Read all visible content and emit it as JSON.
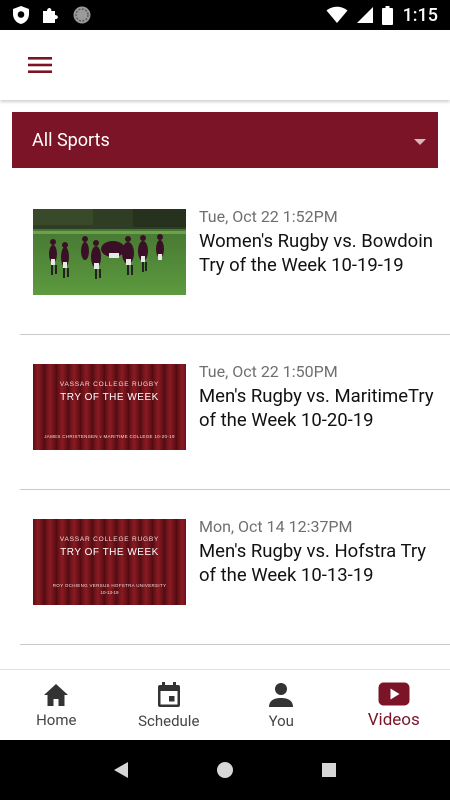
{
  "status_bar": {
    "time": "1:15",
    "icons": [
      "shield-icon",
      "puzzle-icon",
      "circle-icon",
      "wifi-icon",
      "signal-icon",
      "battery-icon"
    ]
  },
  "app_bar": {
    "menu_icon": "hamburger-menu-icon"
  },
  "filter": {
    "label": "All Sports",
    "icon": "dropdown-arrow-icon"
  },
  "videos": [
    {
      "date": "Tue, Oct 22 1:52PM",
      "title": "Women's Rugby vs. Bowdoin Try of the Week 10-19-19",
      "thumbnail": "rugby-field-photo"
    },
    {
      "date": "Tue, Oct 22 1:50PM",
      "title": "Men's Rugby vs. MaritimeTry of the Week 10-20-19",
      "thumbnail": {
        "kind": "curtain-title-card",
        "subtitle": "VASSAR COLLEGE RUGBY",
        "heading": "TRY OF THE WEEK",
        "footer": "JAMES CHRISTENSEN v MARITIME COLLEGE 10-20-19",
        "footer2": ""
      }
    },
    {
      "date": "Mon, Oct 14 12:37PM",
      "title": "Men's Rugby vs. Hofstra Try of the Week 10-13-19",
      "thumbnail": {
        "kind": "curtain-title-card",
        "subtitle": "VASSAR COLLEGE RUGBY",
        "heading": "TRY OF THE WEEK",
        "footer": "ROY OCHIENG VERSUS HOFSTRA UNIVERSITY",
        "footer2": "10-13-19"
      }
    }
  ],
  "bottom_nav": {
    "items": [
      {
        "label": "Home",
        "icon": "home-icon"
      },
      {
        "label": "Schedule",
        "icon": "calendar-icon"
      },
      {
        "label": "You",
        "icon": "person-icon"
      },
      {
        "label": "Videos",
        "icon": "youtube-play-icon"
      }
    ],
    "active": "Videos"
  },
  "system_nav": {
    "icons": [
      "back-triangle-icon",
      "home-circle-icon",
      "recents-square-icon"
    ]
  },
  "colors": {
    "brand": "#7b1426",
    "status_bar": "#000000",
    "divider": "#c9c9c9"
  }
}
